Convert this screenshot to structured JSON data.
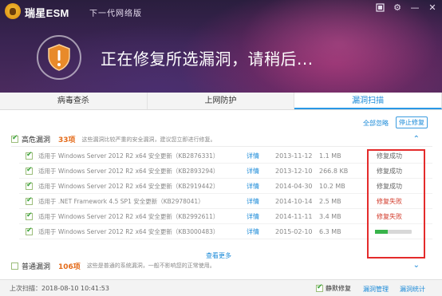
{
  "app": {
    "title": "瑞星ESM",
    "slogan": "下一代网络版",
    "message": "正在修复所选漏洞，请稍后..."
  },
  "tabs": [
    {
      "label": "病毒查杀",
      "active": false
    },
    {
      "label": "上网防护",
      "active": false
    },
    {
      "label": "漏洞扫描",
      "active": true
    }
  ],
  "toolbar": {
    "ignore_all": "全部忽略",
    "stop_repair": "停止修复"
  },
  "high_risk": {
    "title": "高危漏洞",
    "count": "33项",
    "description": "这些漏洞比较严重的安全漏洞，建议您立即进行修复。",
    "color": "#e46b1a"
  },
  "vulns": [
    {
      "name": "适用于 Windows Server 2012 R2 x64 安全更新（KB2876331）",
      "detail": "详情",
      "date": "2013-11-12",
      "size": "1.1 MB",
      "status": "修复成功",
      "state": "ok"
    },
    {
      "name": "适用于 Windows Server 2012 R2 x64 安全更新（KB2893294）",
      "detail": "详情",
      "date": "2013-12-10",
      "size": "266.8 KB",
      "status": "修复成功",
      "state": "ok"
    },
    {
      "name": "适用于 Windows Server 2012 R2 x64 安全更新（KB2919442）",
      "detail": "详情",
      "date": "2014-04-30",
      "size": "10.2 MB",
      "status": "修复成功",
      "state": "ok"
    },
    {
      "name": "适用于 .NET Framework 4.5 SP1 安全更新（KB2978041）",
      "detail": "详情",
      "date": "2014-10-14",
      "size": "2.5 MB",
      "status": "修复失败",
      "state": "fail"
    },
    {
      "name": "适用于 Windows Server 2012 R2 x64 安全更新（KB2992611）",
      "detail": "详情",
      "date": "2014-11-11",
      "size": "3.4 MB",
      "status": "修复失败",
      "state": "fail"
    },
    {
      "name": "适用于 Windows Server 2012 R2 x64 安全更新（KB3000483）",
      "detail": "详情",
      "date": "2015-02-10",
      "size": "6.3 MB",
      "status": "",
      "state": "progress",
      "progress": 0.35
    }
  ],
  "view_more": "查看更多",
  "normal": {
    "title": "普通漏洞",
    "count": "106项",
    "description": "这些是普通的系统漏洞，一般不影响您的正常使用。",
    "color": "#e46b1a"
  },
  "footer": {
    "last_scan": "上次扫描：2018-08-10 10:41:53",
    "silent_repair": "静默修复",
    "vuln_manage": "漏洞管理",
    "vuln_stats": "漏洞统计"
  },
  "colors": {
    "accent": "#1a8ad8",
    "fail": "#d23a2a",
    "progress": "#38b34a",
    "highlight_box": "#e42b2b"
  }
}
